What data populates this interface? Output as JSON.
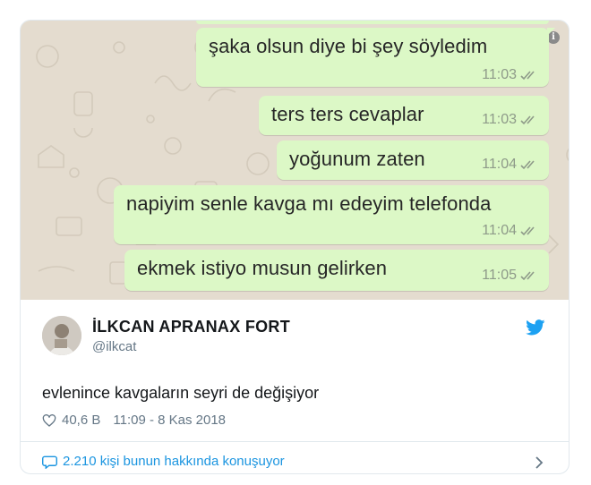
{
  "chat": {
    "messages": [
      {
        "text": "şaka olsun diye bi şey söyledim",
        "time": "11:03"
      },
      {
        "text": "ters ters cevaplar",
        "time": "11:03"
      },
      {
        "text": "yoğunum zaten",
        "time": "11:04"
      },
      {
        "text": "napiyim senle kavga mı edeyim telefonda",
        "time": "11:04"
      },
      {
        "text": "ekmek istiyo musun gelirken",
        "time": "11:05"
      }
    ],
    "bubble_color": "#dcf8c6",
    "wallpaper_color": "#e4dccf",
    "info_icon": "i"
  },
  "tweet": {
    "author_name": "İLKCAN APRANAX FORT",
    "author_handle": "@ilkcat",
    "text": "evlenince kavgaların seyri de değişiyor",
    "likes": "40,6 B",
    "timestamp": "11:09 - 8 Kas 2018",
    "conversation": "2.210 kişi bunun hakkında konuşuyor",
    "brand_color": "#1da1f2",
    "link_color": "#1b95e0"
  }
}
